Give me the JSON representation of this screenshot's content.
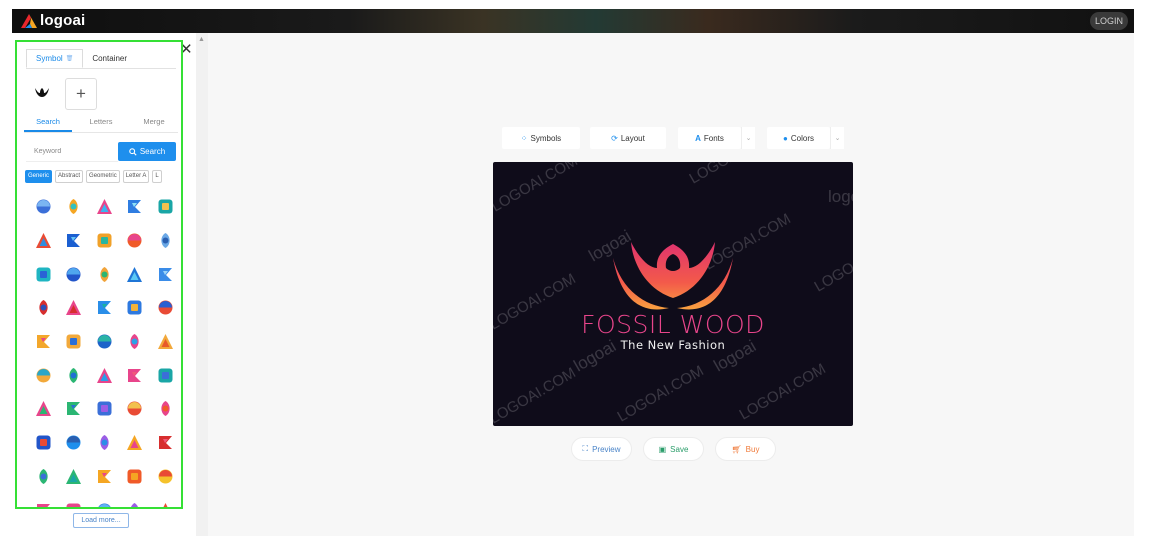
{
  "header": {
    "brand": "logoai",
    "login_label": "LOGIN"
  },
  "sidebar": {
    "tabs": [
      {
        "label": "Symbol"
      },
      {
        "label": "Container"
      }
    ],
    "subtabs": [
      {
        "label": "Search"
      },
      {
        "label": "Letters"
      },
      {
        "label": "Merge"
      }
    ],
    "search": {
      "placeholder": "Keyword",
      "button_label": "Search"
    },
    "chips": [
      "Generic",
      "Abstract",
      "Geometric",
      "Letter A",
      "L"
    ],
    "load_more_label": "Load more..."
  },
  "toolbar": {
    "symbols_label": "Symbols",
    "layout_label": "Layout",
    "fonts_label": "Fonts",
    "colors_label": "Colors"
  },
  "preview": {
    "brand_name": "FOSSIL WOOD",
    "slogan": "The New Fashion",
    "watermarks": [
      "LOGOAI.COM",
      "logoai"
    ]
  },
  "actions": {
    "preview_label": "Preview",
    "save_label": "Save",
    "buy_label": "Buy"
  },
  "colors": {
    "accent": "#1e8fed",
    "selection_outline": "#35e035",
    "canvas_bg": "#0f0c1a",
    "brand_pink": "#e8458b",
    "buy_orange": "#f07a3a"
  },
  "icons": {
    "grid": [
      "blue-layers-icon",
      "rainbow-swirl-icon",
      "rainbow-flower-icon",
      "blue-wing-icon",
      "teal-fold-icon",
      "color-squares-icon",
      "blue-leaf-icon",
      "color-loop-icon",
      "orange-ring-icon",
      "blue-triangle-icon",
      "teal-dots-icon",
      "blue-diamond-icon",
      "green-stripes-icon",
      "blue-petal-icon",
      "blue-star-icon",
      "red-letter-icon",
      "pink-arrow-icon",
      "blue-drop-ring-icon",
      "blue-loop-icon",
      "red-triangle-icon",
      "rainbow-diamond-icon",
      "orange-rings-icon",
      "blue-knot-icon",
      "pink-spiral-icon",
      "orange-fans-icon",
      "orange-star-icon",
      "green-stripes-b-icon",
      "rainbow-drop-icon",
      "pink-play-icon",
      "teal-hexagon-icon",
      "pink-heart-icon",
      "green-slash-icon",
      "blue-diamond-b-icon",
      "rainbow-pinwheel-icon",
      "red-snowflake-icon",
      "rainbow-cross-icon",
      "blue-e-icon",
      "purple-target-icon",
      "orange-flower-icon",
      "red-gear-icon",
      "green-burst-icon",
      "teal-cross-icon",
      "orange-petals-icon",
      "orange-wedge-icon",
      "yellow-fold-icon",
      "rainbow-rings-icon",
      "pink-triangle-icon",
      "blue-s-icon",
      "purple-flower-icon",
      "red-spiral-icon"
    ]
  }
}
